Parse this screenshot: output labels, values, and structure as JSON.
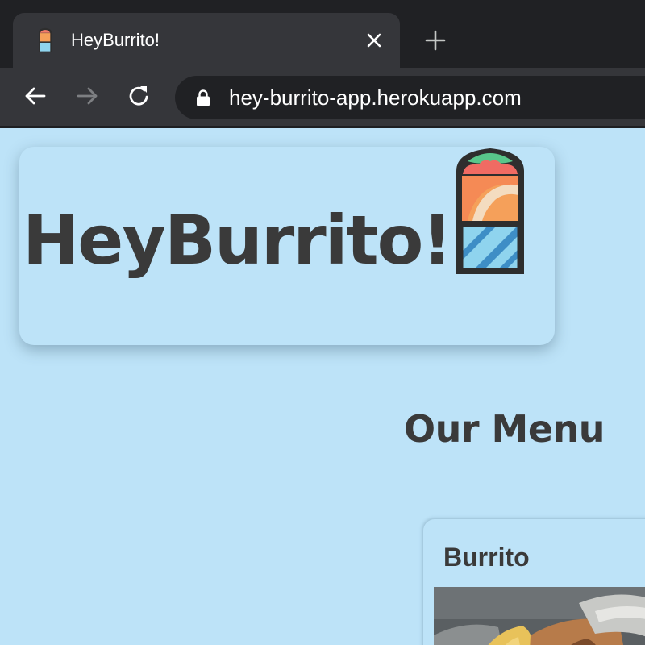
{
  "browser": {
    "tab_title": "HeyBurrito!",
    "url": "hey-burrito-app.herokuapp.com",
    "icons": {
      "favicon": "burrito-icon",
      "close": "close-icon",
      "new_tab": "plus-icon",
      "back": "arrow-left-icon",
      "forward": "arrow-right-icon",
      "reload": "reload-icon",
      "lock": "lock-icon"
    }
  },
  "header": {
    "title": "HeyBurrito!",
    "logo": "burrito-icon"
  },
  "menu": {
    "heading": "Our Menu",
    "items": [
      {
        "name": "Burrito",
        "image": "burrito-photo"
      }
    ]
  },
  "colors": {
    "page_background": "#bde3f8",
    "text": "#3a3a3a",
    "chrome_dark": "#202124",
    "chrome_tab": "#35363a"
  }
}
